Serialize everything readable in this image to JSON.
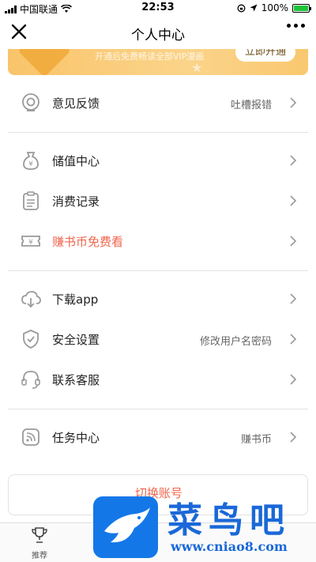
{
  "statusbar": {
    "carrier": "中国联通",
    "time": "22:53",
    "battery": "100%",
    "battery_level": 1.0
  },
  "navbar": {
    "title": "个人中心"
  },
  "vip_banner": {
    "subtitle": "开通后免费畅读全部VIP漫画",
    "button": "立即开通"
  },
  "menu": {
    "feedback": {
      "label": "意见反馈",
      "extra": "吐槽报错"
    },
    "recharge": {
      "label": "储值中心"
    },
    "records": {
      "label": "消费记录"
    },
    "earn_coins": {
      "label": "赚书币免费看"
    },
    "download": {
      "label": "下载app"
    },
    "security": {
      "label": "安全设置",
      "extra": "修改用户名密码"
    },
    "support": {
      "label": "联系客服"
    },
    "tasks": {
      "label": "任务中心",
      "extra": "赚书币"
    }
  },
  "logout": {
    "label": "切换账号"
  },
  "tabbar": {
    "items": [
      {
        "label": "推荐",
        "icon": "trophy-icon"
      }
    ]
  },
  "watermark": {
    "title": "菜鸟吧",
    "url": "www.cniao8.com"
  },
  "colors": {
    "accent_red": "#f0654d",
    "banner_gold": "#f9c46a",
    "icon_gray": "#9a9a9a",
    "watermark_blue": "#1477e8"
  }
}
